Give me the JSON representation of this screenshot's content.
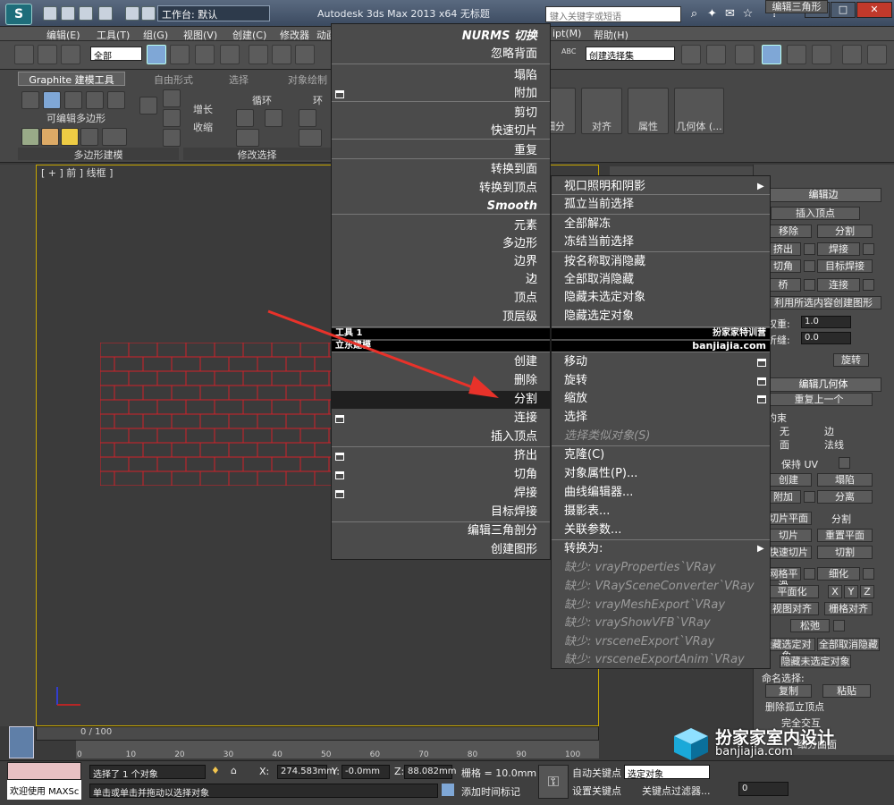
{
  "titlebar": {
    "workspace": "工作台: 默认",
    "app_title": "Autodesk 3ds Max  2013 x64      无标题",
    "search_placeholder": "键入关键字或短语"
  },
  "menubar": {
    "items": [
      "编辑(E)",
      "工具(T)",
      "组(G)",
      "视图(V)",
      "创建(C)",
      "修改器",
      "动画",
      "ipt(M)",
      "帮助(H)"
    ]
  },
  "toolbar": {
    "selection_filter": "全部",
    "named_selection_sets": "创建选择集",
    "abc_label": "ABC"
  },
  "ribbon": {
    "tabs": [
      "Graphite 建模工具",
      "自由形式",
      "选择",
      "对象绘制"
    ],
    "editable_poly": "可编辑多边形",
    "grow": "增长",
    "shrink": "收缩",
    "loop": "循环",
    "ring": "环",
    "sections": [
      "多边形建模",
      "修改选择"
    ],
    "big_buttons": [
      "细分",
      "对齐",
      "属性",
      "几何体 (..."
    ]
  },
  "viewport": {
    "label": "[ + ] 前 ] 线框 ]"
  },
  "quad_left": {
    "group1": [
      "NURMS 切换",
      "忽略背面",
      "塌陷",
      "附加",
      "剪切",
      "快速切片",
      "重复",
      "转换到面",
      "转换到顶点",
      "Smooth",
      "元素",
      "多边形",
      "边界",
      "边",
      "顶点",
      "顶层级"
    ],
    "header_tools1": "工具 1",
    "header_tools2": "立东建模",
    "group2": [
      "创建",
      "删除",
      "分割",
      "连接",
      "插入顶点",
      "挤出",
      "切角",
      "焊接",
      "目标焊接",
      "编辑三角剖分",
      "创建图形"
    ]
  },
  "quad_right": {
    "group1": [
      "视口照明和阴影",
      "孤立当前选择",
      "全部解冻",
      "冻结当前选择",
      "按名称取消隐藏",
      "全部取消隐藏",
      "隐藏未选定对象",
      "隐藏选定对象"
    ],
    "header_brand": "扮家家特训营",
    "header_url": "banjiajia.com",
    "group2": [
      "移动",
      "旋转",
      "缩放",
      "选择",
      "选择类似对象(S)",
      "克隆(C)",
      "对象属性(P)...",
      "曲线编辑器...",
      "摄影表...",
      "关联参数...",
      "转换为:",
      "缺少: vrayProperties`VRay",
      "缺少: VRaySceneConverter`VRay",
      "缺少: vrayMeshExport`VRay",
      "缺少: vrayShowVFB`VRay",
      "缺少: vrsceneExport`VRay",
      "缺少: vrsceneExportAnim`VRay"
    ]
  },
  "command_panel": {
    "rollout_edit_edges": "编辑边",
    "insert_vertex": "插入顶点",
    "remove": "移除",
    "split": "分割",
    "extrude": "挤出",
    "weld": "焊接",
    "chamfer": "切角",
    "target_weld": "目标焊接",
    "bridge": "桥",
    "connect": "连接",
    "create_shape": "利用所选内容创建图形",
    "weight_label": "权重:",
    "weight_value": "1.0",
    "crease_label": "折缝:",
    "crease_value": "0.0",
    "edit_tri": "编辑三角形",
    "turn": "旋转",
    "rollout_edit_geometry": "编辑几何体",
    "repeat_last": "重复上一个",
    "constraints": "约束",
    "c_none": "无",
    "c_edge": "边",
    "c_face": "面",
    "c_normal": "法线",
    "preserve_uv": "保持 UV",
    "create": "创建",
    "collapse": "塌陷",
    "attach": "附加",
    "detach": "分离",
    "slice_plane": "切片平面",
    "split_chk": "分割",
    "slice": "切片",
    "reset_plane": "重置平面",
    "quickslice": "快速切片",
    "cut": "切割",
    "meshsmooth": "网格平滑",
    "tessellate": "细化",
    "planarize": "平面化",
    "x": "X",
    "y": "Y",
    "z": "Z",
    "view_align": "视图对齐",
    "grid_align": "栅格对齐",
    "relax": "松弛",
    "hide_selected": "隐藏选定对象",
    "unhide_all": "全部取消隐藏",
    "hide_unselected": "隐藏未选定对象",
    "named_selections": "命名选择:",
    "copy": "复制",
    "paste": "粘贴",
    "delete_isolated": "删除孤立顶点",
    "full_interactivity": "完全交互",
    "subdivision": "细分曲面"
  },
  "timeline": {
    "frame": "0 / 100",
    "ticks": [
      "0",
      "10",
      "20",
      "30",
      "40",
      "50",
      "60",
      "70",
      "80",
      "90",
      "100"
    ]
  },
  "status": {
    "welcome": "欢迎使用 MAXSc",
    "selected": "选择了 1 个对象",
    "prompt": "单击或单击并拖动以选择对象",
    "x_label": "X:",
    "x_value": "274.583mm",
    "y_label": "Y:",
    "y_value": "-0.0mm",
    "z_label": "Z:",
    "z_value": "88.082mm",
    "grid": "栅格 = 10.0mm",
    "auto_key": "自动关键点",
    "set_key": "设置关键点",
    "selected_obj": "选定对象",
    "key_filters": "关键点过滤器...",
    "add_time_tag": "添加时间标记",
    "frame_field": "0"
  },
  "watermark": {
    "name": "扮家家室内设计",
    "url": "banjiajia.com"
  },
  "colors": {
    "highlight": "#1f1f1f",
    "arrow": "#e8322a",
    "brick_line": "#d0202a",
    "viewport_border": "#c8a800"
  }
}
